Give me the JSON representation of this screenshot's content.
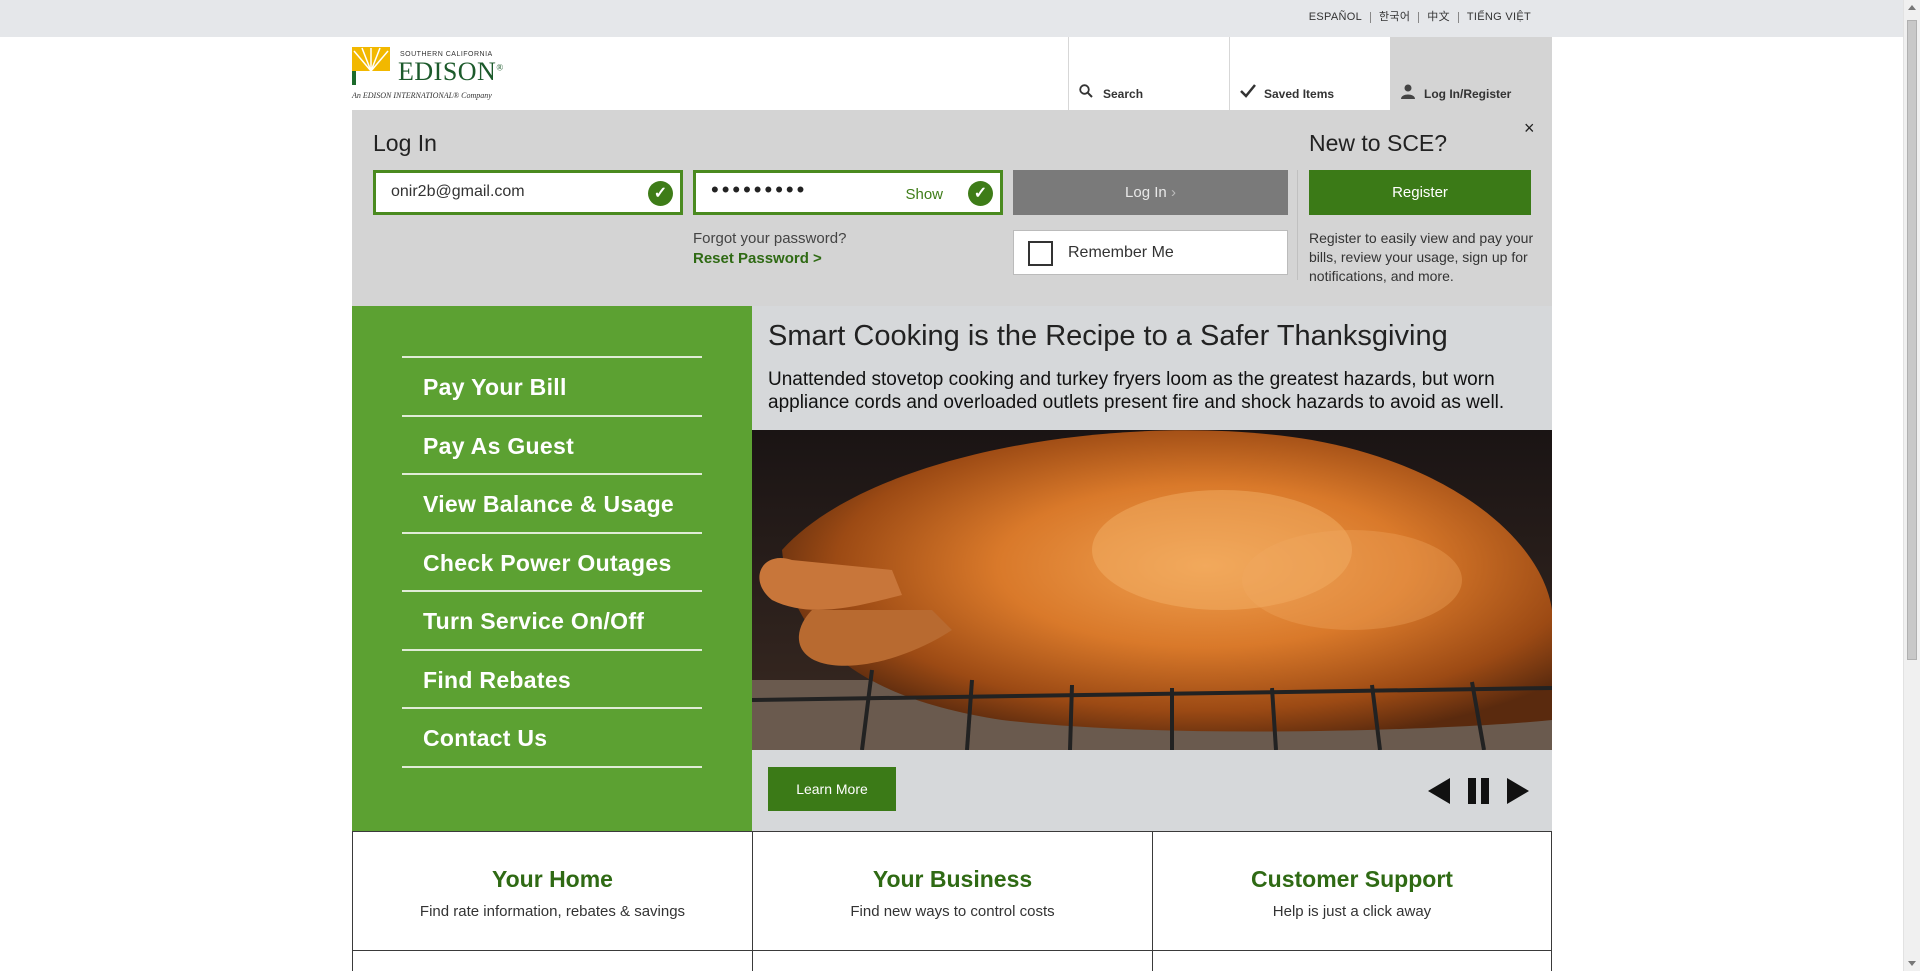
{
  "languages": [
    "ESPAÑOL",
    "한국어",
    "中文",
    "TIẾNG VIỆT"
  ],
  "logo": {
    "small": "SOUTHERN CALIFORNIA",
    "name": "EDISON",
    "reg": "®",
    "tagline": "An EDISON INTERNATIONAL® Company"
  },
  "nav": {
    "search": "Search",
    "saved": "Saved Items",
    "login": "Log In/Register"
  },
  "login": {
    "title": "Log In",
    "email_value": "onir2b@gmail.com",
    "password_mask": "•••••••••",
    "show_label": "Show",
    "forgot_text": "Forgot your password?",
    "reset_link": "Reset Password >",
    "login_button": "Log In",
    "remember_label": "Remember Me",
    "new_title": "New to SCE?",
    "register_button": "Register",
    "register_text": "Register to easily view and pay your bills, review your usage, sign up for notifications, and more.",
    "close": "×"
  },
  "quick_links": [
    "Pay Your Bill",
    "Pay As Guest",
    "View Balance & Usage",
    "Check Power Outages",
    "Turn Service On/Off",
    "Find Rebates",
    "Contact Us"
  ],
  "hero": {
    "title": "Smart Cooking is the Recipe to a Safer Thanksgiving",
    "subtitle": "Unattended stovetop cooking and turkey fryers loom as the greatest hazards, but worn appliance cords and overloaded outlets present fire and shock hazards to avoid as well.",
    "learn_more": "Learn More"
  },
  "tiles": [
    {
      "title": "Your Home",
      "desc": "Find rate information, rebates & savings"
    },
    {
      "title": "Your Business",
      "desc": "Find new ways to control costs"
    },
    {
      "title": "Customer Support",
      "desc": "Help is just a click away"
    }
  ],
  "colors": {
    "brand_green": "#3b7a17",
    "nav_green": "#5ca132",
    "panel_gray": "#d4d4d4"
  }
}
